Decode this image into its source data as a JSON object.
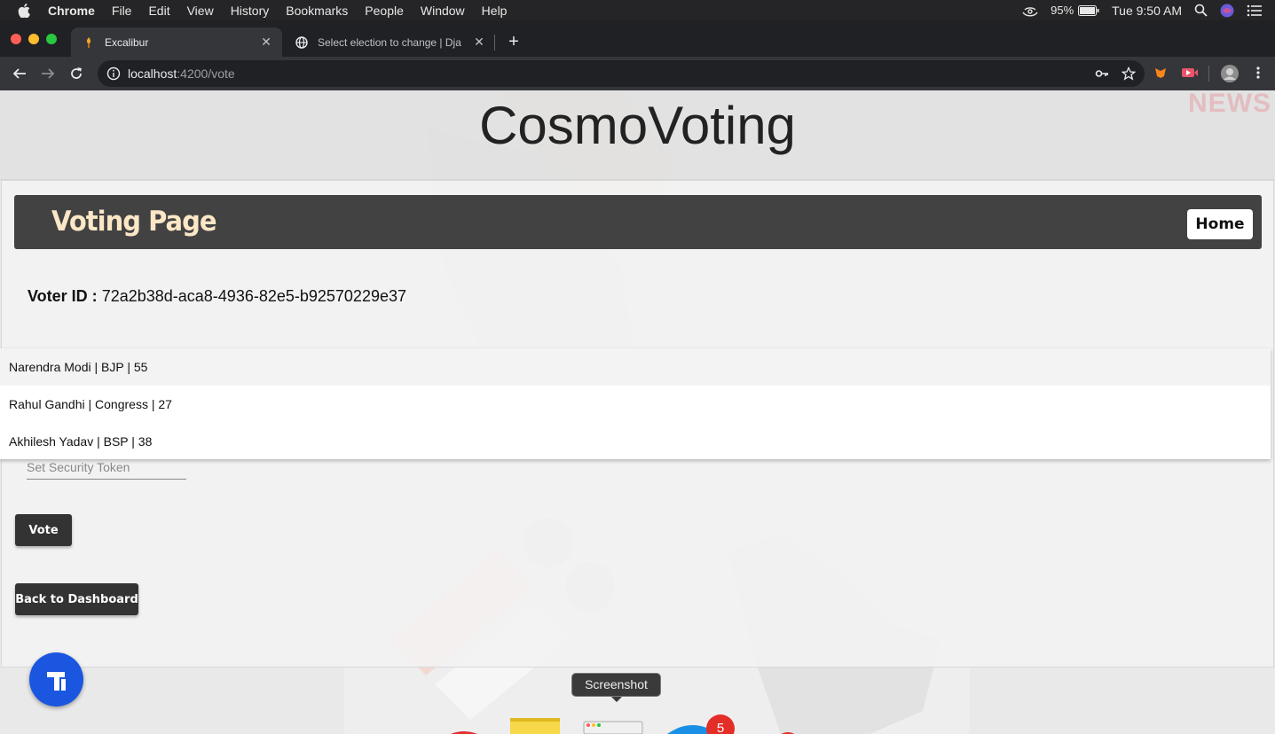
{
  "menubar": {
    "app": "Chrome",
    "items": [
      "File",
      "Edit",
      "View",
      "History",
      "Bookmarks",
      "People",
      "Window",
      "Help"
    ],
    "battery": "95%",
    "clock": "Tue 9:50 AM"
  },
  "tabs": [
    {
      "title": "Excalibur",
      "active": true
    },
    {
      "title": "Select election to change | Dja",
      "active": false
    }
  ],
  "address": {
    "host": "localhost",
    "path": ":4200/vote"
  },
  "page": {
    "site_title": "CosmoVoting",
    "watermark": "NEWS",
    "nav_brand": "Voting Page",
    "home_label": "Home",
    "voter_label": "Voter ID :",
    "voter_id": "72a2b38d-aca8-4936-82e5-b92570229e37",
    "candidates": [
      "Narendra Modi | BJP | 55",
      "Rahul Gandhi | Congress | 27",
      "Akhilesh Yadav | BSP | 38"
    ],
    "token_placeholder": "Set Security Token",
    "vote_label": "Vote",
    "dashboard_label": "Back to Dashboard"
  },
  "dock": {
    "tooltip": "Screenshot",
    "badge": "5"
  },
  "colors": {
    "navbar": "#424242",
    "brand_text": "#fbe7c6",
    "fab": "#1a56e0"
  }
}
